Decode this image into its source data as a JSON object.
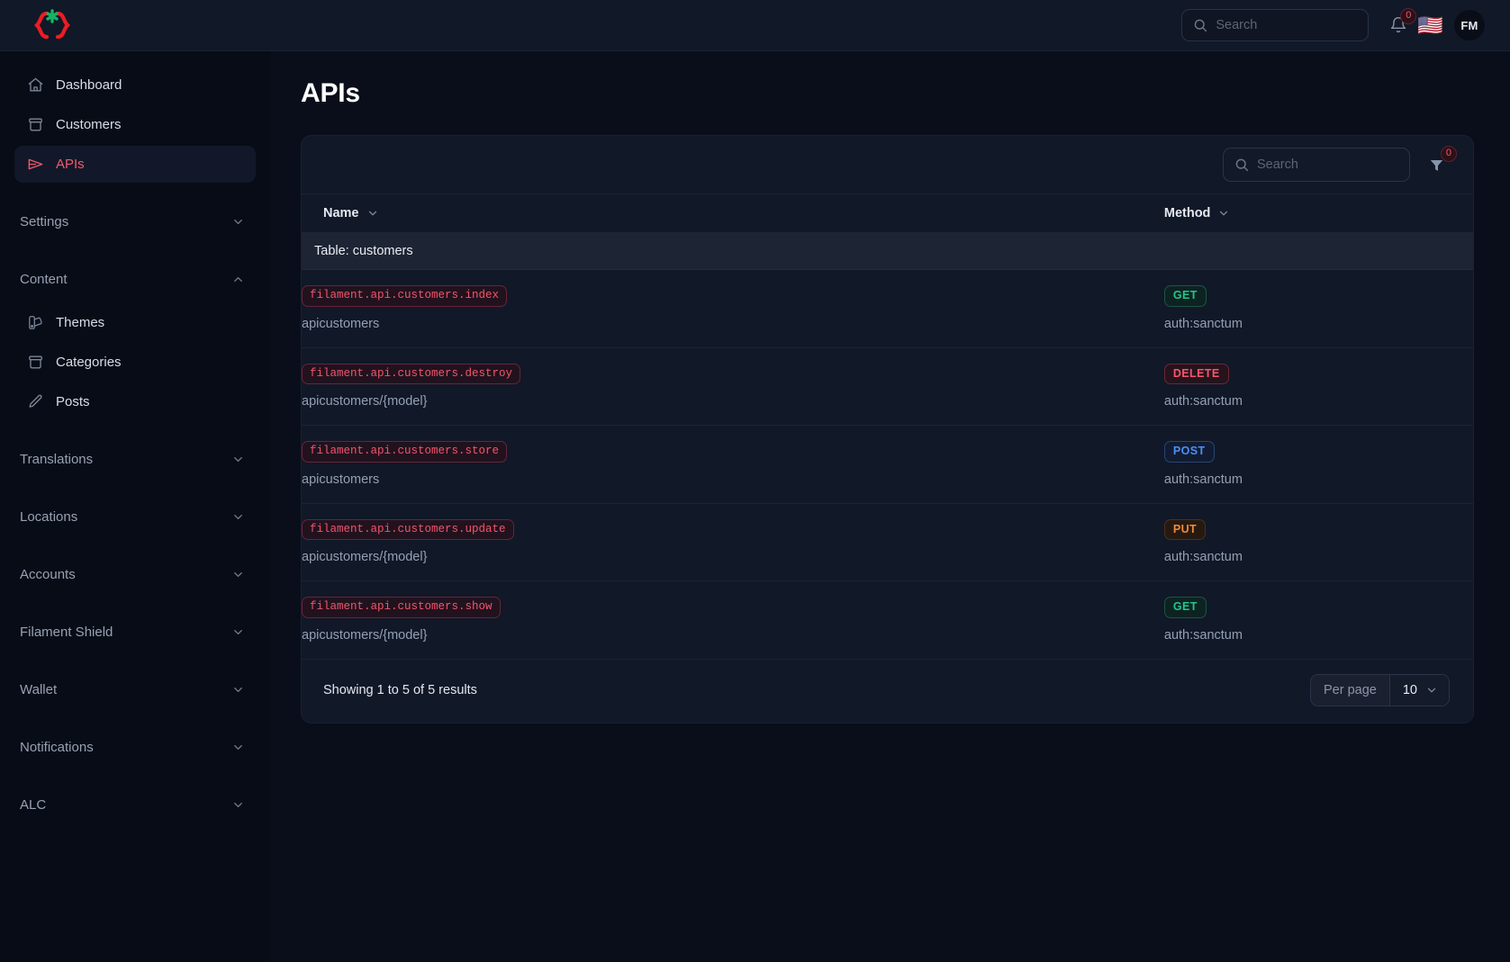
{
  "topbar": {
    "logo_name": "braces-asterisk-logo",
    "search": {
      "value": "",
      "placeholder": "Search"
    },
    "notifications": {
      "icon": "bell-icon",
      "count": "0"
    },
    "locale_flag": "🇺🇸",
    "avatar_initials": "FM"
  },
  "sidebar": {
    "items": [
      {
        "label": "Dashboard",
        "icon": "home-icon",
        "active": false
      },
      {
        "label": "Customers",
        "icon": "archive-box-icon",
        "active": false
      },
      {
        "label": "APIs",
        "icon": "paper-airplane-icon",
        "active": true
      }
    ],
    "groups": [
      {
        "label": "Settings",
        "expanded": false,
        "chevron": "chevron-down-icon",
        "items": []
      },
      {
        "label": "Content",
        "expanded": true,
        "chevron": "chevron-up-icon",
        "items": [
          {
            "label": "Themes",
            "icon": "swatch-icon"
          },
          {
            "label": "Categories",
            "icon": "archive-box-icon"
          },
          {
            "label": "Posts",
            "icon": "pencil-icon"
          }
        ]
      },
      {
        "label": "Translations",
        "expanded": false,
        "chevron": "chevron-down-icon",
        "items": []
      },
      {
        "label": "Locations",
        "expanded": false,
        "chevron": "chevron-down-icon",
        "items": []
      },
      {
        "label": "Accounts",
        "expanded": false,
        "chevron": "chevron-down-icon",
        "items": []
      },
      {
        "label": "Filament Shield",
        "expanded": false,
        "chevron": "chevron-down-icon",
        "items": []
      },
      {
        "label": "Wallet",
        "expanded": false,
        "chevron": "chevron-down-icon",
        "items": []
      },
      {
        "label": "Notifications",
        "expanded": false,
        "chevron": "chevron-down-icon",
        "items": []
      },
      {
        "label": "ALC",
        "expanded": false,
        "chevron": "chevron-down-icon",
        "items": []
      }
    ]
  },
  "main": {
    "page_title": "APIs",
    "toolbar": {
      "search": {
        "value": "",
        "placeholder": "Search"
      },
      "filter": {
        "icon": "funnel-icon",
        "count": "0"
      }
    },
    "table": {
      "columns": [
        {
          "label": "Name",
          "sortable": true
        },
        {
          "label": "Method",
          "sortable": true
        }
      ],
      "group_label": "Table: customers",
      "rows": [
        {
          "route": "filament.api.customers.index",
          "uri": "apicustomers",
          "method": "GET",
          "middleware": "auth:sanctum"
        },
        {
          "route": "filament.api.customers.destroy",
          "uri": "apicustomers/{model}",
          "method": "DELETE",
          "middleware": "auth:sanctum"
        },
        {
          "route": "filament.api.customers.store",
          "uri": "apicustomers",
          "method": "POST",
          "middleware": "auth:sanctum"
        },
        {
          "route": "filament.api.customers.update",
          "uri": "apicustomers/{model}",
          "method": "PUT",
          "middleware": "auth:sanctum"
        },
        {
          "route": "filament.api.customers.show",
          "uri": "apicustomers/{model}",
          "method": "GET",
          "middleware": "auth:sanctum"
        }
      ]
    },
    "footer": {
      "results_text": "Showing 1 to 5 of 5 results",
      "per_page_label": "Per page",
      "per_page_value": "10"
    }
  },
  "colors": {
    "accent_red": "#f0566c",
    "accent_green": "#24c58a",
    "method_get": "#24c58a",
    "method_post": "#4f8ef7",
    "method_put": "#ef8b3c",
    "method_delete": "#f4566e",
    "page_bg": "#0a0e1a",
    "sidebar_bg": "#080c16",
    "card_bg": "#111827"
  }
}
